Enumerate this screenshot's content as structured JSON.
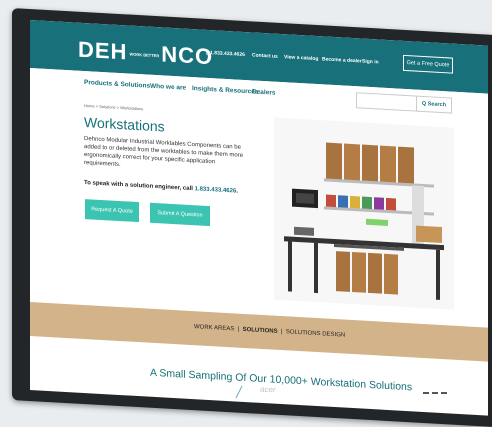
{
  "header": {
    "logo_part1": "DEH",
    "logo_small": "WORK BETTER",
    "logo_part2": "NCO",
    "phone": "1.833.433.4626",
    "contact": "Contact us",
    "catalog": "View a catalog",
    "dealer": "Become a dealer",
    "signin": "Sign in",
    "quote_button": "Get a Free Quote"
  },
  "nav": {
    "items": [
      "Products & Solutions",
      "Who we are",
      "Insights & Resources",
      "Dealers"
    ],
    "search_placeholder": "",
    "search_button": "Q Search"
  },
  "content": {
    "breadcrumb": "Home >  Solutions >  Workstations",
    "title": "Workstations",
    "description": "Dehnco Modular Industrial Worktables Components can be added to or deleted from the worktables to make them more ergonomically correct for your specific application requirements.",
    "callout_text": "To speak with a solution engineer, call ",
    "callout_phone": "1.833.433.4626",
    "callout_end": ".",
    "btn_quote": "Request A Quote",
    "btn_question": "Submit A Question"
  },
  "strip": {
    "link1": "WORK AREAS",
    "link2": "SOLUTIONS",
    "link3": "SOLUTIONS DESIGN"
  },
  "bottom_heading": "A Small Sampling Of Our 10,000+ Workstation Solutions",
  "monitor_brand": "acer",
  "colors": {
    "teal": "#17707a",
    "button": "#3cc4b2",
    "strip": "#d3b48a"
  }
}
